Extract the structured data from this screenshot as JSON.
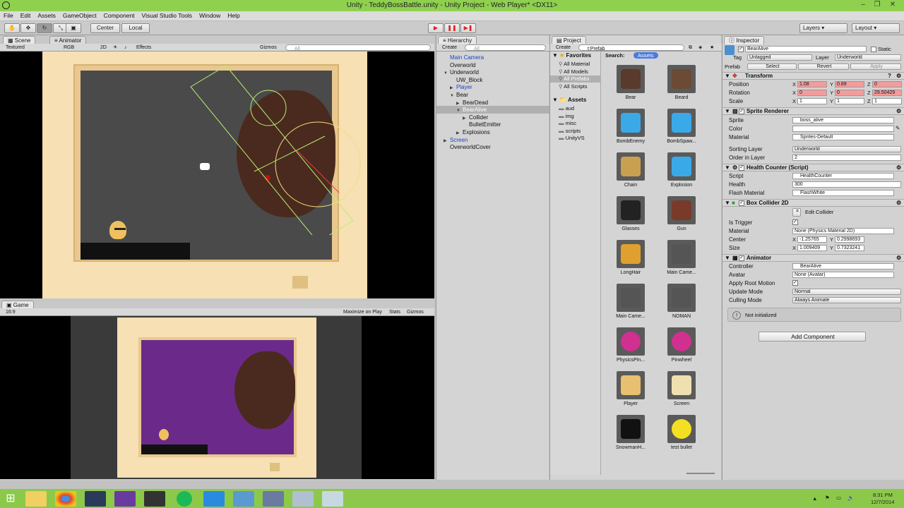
{
  "window": {
    "title": "Unity - TeddyBossBattle.unity - Unity Project - Web Player* <DX11>"
  },
  "menu": [
    "File",
    "Edit",
    "Assets",
    "GameObject",
    "Component",
    "Visual Studio Tools",
    "Window",
    "Help"
  ],
  "toolbar": {
    "center_label": "Center",
    "local_label": "Local",
    "layers_label": "Layers",
    "layout_label": "Layout"
  },
  "scene": {
    "tab_scene": "Scene",
    "tab_animator": "Animator",
    "shading": "Textured",
    "render_mode": "RGB",
    "mode_2d": "2D",
    "effects": "Effects",
    "gizmos": "Gizmos",
    "search_placeholder": "All"
  },
  "game": {
    "tab": "Game",
    "aspect": "16:9",
    "maximize": "Maximize on Play",
    "stats": "Stats",
    "gizmos": "Gizmos"
  },
  "hierarchy": {
    "tab": "Hierarchy",
    "create": "Create",
    "search_placeholder": "All",
    "items": [
      {
        "label": "Main Camera",
        "indent": 0,
        "blue": true,
        "arrow": ""
      },
      {
        "label": "Overworld",
        "indent": 0,
        "blue": false,
        "arrow": ""
      },
      {
        "label": "Underworld",
        "indent": 0,
        "blue": false,
        "arrow": "▼"
      },
      {
        "label": "UW_Block",
        "indent": 1,
        "blue": false,
        "arrow": ""
      },
      {
        "label": "Player",
        "indent": 1,
        "blue": true,
        "arrow": "▶"
      },
      {
        "label": "Bear",
        "indent": 1,
        "blue": false,
        "arrow": "▼"
      },
      {
        "label": "BearDead",
        "indent": 2,
        "blue": false,
        "arrow": "▶"
      },
      {
        "label": "BearAlive",
        "indent": 2,
        "blue": false,
        "arrow": "▼",
        "selected": true
      },
      {
        "label": "Collider",
        "indent": 3,
        "blue": false,
        "arrow": "▶"
      },
      {
        "label": "BulletEmitter",
        "indent": 3,
        "blue": false,
        "arrow": ""
      },
      {
        "label": "Explosions",
        "indent": 2,
        "blue": false,
        "arrow": "▶"
      },
      {
        "label": "Screen",
        "indent": 0,
        "blue": true,
        "arrow": "▶"
      },
      {
        "label": "OverworldCover",
        "indent": 0,
        "blue": false,
        "arrow": ""
      }
    ]
  },
  "project": {
    "tab": "Project",
    "create": "Create",
    "search_value": "t:Prefab",
    "search_label": "Search:",
    "search_scope": "Assets",
    "favorites_label": "Favorites",
    "favorites": [
      "All Material",
      "All Models",
      "All Prefabs",
      "All Scripts"
    ],
    "assets_label": "Assets",
    "folders": [
      "aud",
      "img",
      "misc",
      "scripts",
      "UnityVS"
    ],
    "items": [
      {
        "label": "Bear",
        "color": "#5a3a2a"
      },
      {
        "label": "Beard",
        "color": "#6b4a36"
      },
      {
        "label": "BombEnemy",
        "color": "#3aa9e8"
      },
      {
        "label": "BombSpaw...",
        "color": "#3aa9e8"
      },
      {
        "label": "Chain",
        "color": "#c8a050"
      },
      {
        "label": "Explosion",
        "color": "#3aa9e8"
      },
      {
        "label": "Glasses",
        "color": "#222222"
      },
      {
        "label": "Gun",
        "color": "#7a3a2a"
      },
      {
        "label": "LongHair",
        "color": "#e0a030"
      },
      {
        "label": "Main Came...",
        "color": "#555555"
      },
      {
        "label": "Main Came...",
        "color": "#555555"
      },
      {
        "label": "NOMAN",
        "color": "#555555"
      },
      {
        "label": "PhysicsPin...",
        "color": "#d03090"
      },
      {
        "label": "Pinwheel",
        "color": "#d03090"
      },
      {
        "label": "Player",
        "color": "#e8c070"
      },
      {
        "label": "Screen",
        "color": "#efe0b0"
      },
      {
        "label": "SnowmanH...",
        "color": "#111111"
      },
      {
        "label": "test bullet",
        "color": "#f4e020"
      }
    ]
  },
  "inspector": {
    "tab": "Inspector",
    "object_name": "BearAlive",
    "static_label": "Static",
    "tag_label": "Tag",
    "tag_value": "Untagged",
    "layer_label": "Layer",
    "layer_value": "Underworld",
    "prefab_label": "Prefab",
    "select_label": "Select",
    "revert_label": "Revert",
    "apply_label": "Apply",
    "transform": {
      "title": "Transform",
      "position_label": "Position",
      "rotation_label": "Rotation",
      "scale_label": "Scale",
      "pos": {
        "x": "1.08",
        "y": "0.89",
        "z": "0"
      },
      "rot": {
        "x": "0",
        "y": "0",
        "z": "29.50429"
      },
      "scl": {
        "x": "1",
        "y": "1",
        "z": "1"
      }
    },
    "sprite_renderer": {
      "title": "Sprite Renderer",
      "sprite_label": "Sprite",
      "sprite_value": "boss_alive",
      "color_label": "Color",
      "material_label": "Material",
      "material_value": "Sprites-Default",
      "sorting_label": "Sorting Layer",
      "sorting_value": "Underworld",
      "order_label": "Order in Layer",
      "order_value": "2"
    },
    "health": {
      "title": "Health Counter (Script)",
      "script_label": "Script",
      "script_value": "HealthCounter",
      "health_label": "Health",
      "health_value": "300",
      "flash_label": "Flash Material",
      "flash_value": "FlashWhite"
    },
    "box": {
      "title": "Box Collider 2D",
      "edit_label": "Edit Collider",
      "trigger_label": "Is Trigger",
      "material_label": "Material",
      "material_value": "None (Physics Material 2D)",
      "center_label": "Center",
      "center_x": "-1.25765",
      "center_y": "0.2998693",
      "size_label": "Size",
      "size_x": "1.009409",
      "size_y": "0.7323241"
    },
    "animator": {
      "title": "Animator",
      "controller_label": "Controller",
      "controller_value": "BearAlive",
      "avatar_label": "Avatar",
      "avatar_value": "None (Avatar)",
      "root_label": "Apply Root Motion",
      "update_label": "Update Mode",
      "update_value": "Normal",
      "culling_label": "Culling Mode",
      "culling_value": "Always Animate",
      "not_init": "Not initialized"
    },
    "add_component": "Add Component"
  },
  "taskbar": {
    "time": "8:31 PM",
    "date": "12/7/2014"
  },
  "colors": {
    "titlebar": "#8fd14f",
    "taskbar": "#8cc94a",
    "game_bg": "#6b2a8a",
    "scene_bg": "#4a4a4a",
    "frame": "#f6e0b4"
  }
}
